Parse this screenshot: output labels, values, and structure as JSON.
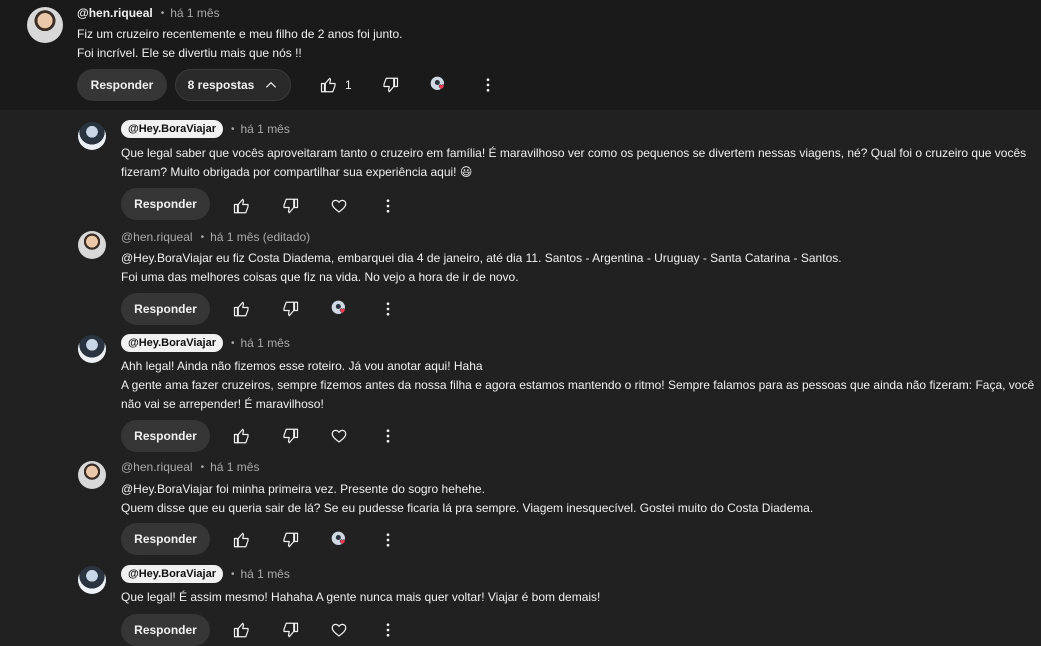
{
  "top_comment": {
    "author": "@hen.riqueal",
    "time": "há 1 mês",
    "lines": [
      "Fiz um cruzeiro recentemente e meu filho de 2 anos foi junto.",
      "Foi incrível. Ele se divertiu mais que nós !!"
    ],
    "reply_label": "Responder",
    "replies_label": "8 respostas",
    "likes": "1"
  },
  "replies": [
    {
      "author": "@Hey.BoraViajar",
      "creator": true,
      "time": "há 1 mês",
      "lines": [
        "Que legal saber que vocês aproveitaram tanto o cruzeiro em família! É maravilhoso ver como os pequenos se divertem nessas viagens, né? Qual foi o cruzeiro que vocês",
        "fizeram? Muito obrigada por compartilhar sua experiência aqui! 😃"
      ],
      "reply_label": "Responder"
    },
    {
      "author": "@hen.riqueal",
      "creator": false,
      "time": "há 1 mês (editado)",
      "lines": [
        "@Hey.BoraViajar  eu fiz Costa Diadema, embarquei dia 4 de janeiro, até dia 11. Santos - Argentina - Uruguay - Santa Catarina - Santos.",
        "Foi uma das melhores coisas que fiz na vida. No vejo a hora de ir de novo."
      ],
      "reply_label": "Responder"
    },
    {
      "author": "@Hey.BoraViajar",
      "creator": true,
      "time": "há 1 mês",
      "lines": [
        "Ahh legal! Ainda não fizemos esse roteiro. Já vou anotar aqui! Haha",
        "A gente ama fazer cruzeiros, sempre fizemos antes da nossa filha e agora estamos mantendo o ritmo! Sempre falamos para as pessoas que ainda não fizeram: Faça, você",
        "não vai se arrepender! É maravilhoso!"
      ],
      "reply_label": "Responder"
    },
    {
      "author": "@hen.riqueal",
      "creator": false,
      "time": "há 1 mês",
      "lines": [
        "@Hey.BoraViajar foi minha primeira vez. Presente do sogro hehehe.",
        "Quem disse que eu queria sair de lá? Se eu pudesse ficaria lá pra sempre. Viagem inesquecível. Gostei muito do Costa Diadema."
      ],
      "reply_label": "Responder"
    },
    {
      "author": "@Hey.BoraViajar",
      "creator": true,
      "time": "há 1 mês",
      "lines": [
        "Que legal! É assim mesmo! Hahaha A gente nunca mais quer voltar! Viajar é bom demais!"
      ],
      "reply_label": "Responder"
    }
  ],
  "icons": {
    "like": "thumbs-up-icon",
    "dislike": "thumbs-down-icon",
    "heart": "heart-outline-icon",
    "creator_heart": "creator-heart-icon",
    "more": "more-vert-icon",
    "chevron": "chevron-up-icon"
  },
  "colors": {
    "background": "#212121",
    "chip": "#f1f1f1",
    "heart": "#ff3b55"
  }
}
